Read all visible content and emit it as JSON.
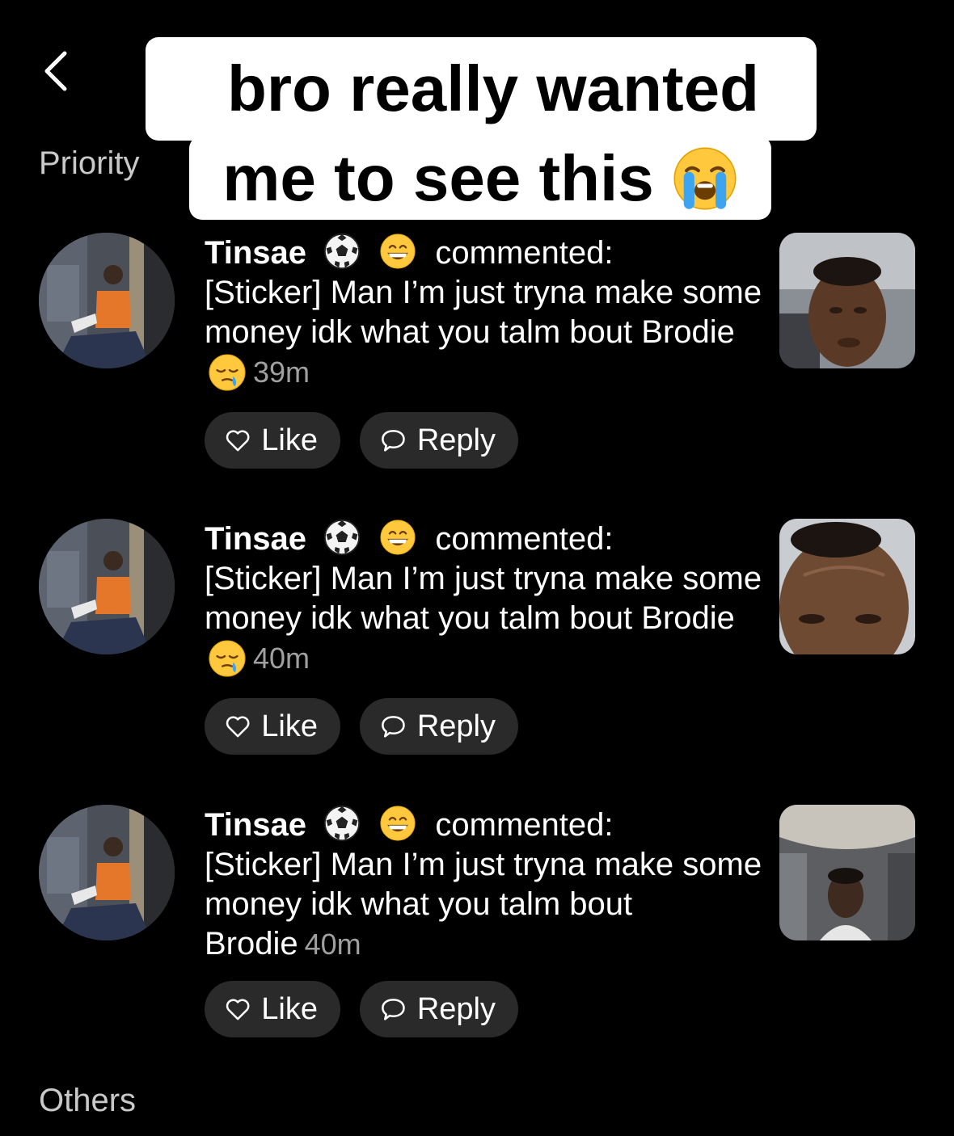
{
  "header": {
    "back_icon": "chevron-left-icon"
  },
  "caption": {
    "line1": "bro really wanted",
    "line2": "me to see this",
    "emoji": "loudly-crying-face-emoji"
  },
  "sections": {
    "priority": "Priority",
    "others": "Others"
  },
  "notifications": [
    {
      "username": "Tinsae",
      "badges": [
        "soccer-ball-emoji",
        "grinning-face-emoji"
      ],
      "action": "commented:",
      "comment": "[Sticker] Man I’m just tryna make some money idk what you talm bout Brodie",
      "trailing_emoji": "sleepy-face-emoji",
      "time": "39m",
      "like_label": "Like",
      "reply_label": "Reply"
    },
    {
      "username": "Tinsae",
      "badges": [
        "soccer-ball-emoji",
        "grinning-face-emoji"
      ],
      "action": "commented:",
      "comment": "[Sticker] Man I’m just tryna make some money idk what you talm bout Brodie",
      "trailing_emoji": "sleepy-face-emoji",
      "time": "40m",
      "like_label": "Like",
      "reply_label": "Reply"
    },
    {
      "username": "Tinsae",
      "badges": [
        "soccer-ball-emoji",
        "grinning-face-emoji"
      ],
      "action": "commented:",
      "comment": "[Sticker] Man I’m just tryna make some money idk what you talm bout Brodie",
      "trailing_emoji": "",
      "time": "40m",
      "like_label": "Like",
      "reply_label": "Reply"
    }
  ],
  "colors": {
    "background": "#000000",
    "pill": "#2a2a2a",
    "muted_text": "#a0a0a0",
    "section_label": "#c9c9c9",
    "caption_bg": "#ffffff"
  }
}
